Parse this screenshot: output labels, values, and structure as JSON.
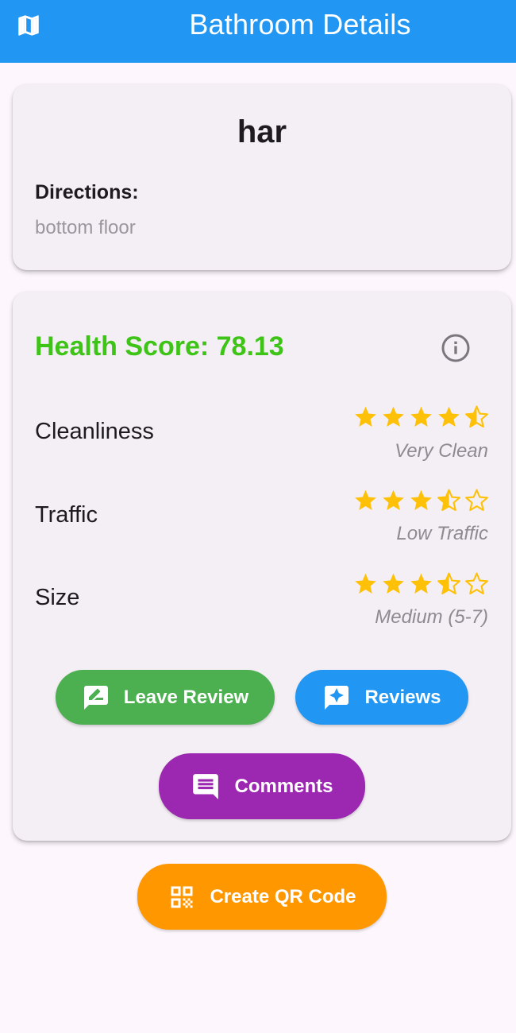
{
  "appbar": {
    "title": "Bathroom Details",
    "map_icon": "map-icon"
  },
  "bathroom": {
    "name": "har",
    "directions_label": "Directions:",
    "directions_value": "bottom floor"
  },
  "health": {
    "text": "Health Score: 78.13",
    "color": "#3dc416",
    "info_icon": "info-outline-icon"
  },
  "ratings": [
    {
      "label": "Cleanliness",
      "stars": 4.5,
      "max": 5,
      "description": "Very Clean"
    },
    {
      "label": "Traffic",
      "stars": 3.5,
      "max": 5,
      "description": "Low Traffic"
    },
    {
      "label": "Size",
      "stars": 3.5,
      "max": 5,
      "description": "Medium (5-7)"
    }
  ],
  "buttons": {
    "leave_review": {
      "label": "Leave Review",
      "icon": "rate-review-icon",
      "color": "#4caf50"
    },
    "reviews": {
      "label": "Reviews",
      "icon": "reviews-icon",
      "color": "#2196f3"
    },
    "comments": {
      "label": "Comments",
      "icon": "comment-icon",
      "color": "#9c27b0"
    },
    "qr": {
      "label": "Create QR Code",
      "icon": "qr-code-icon",
      "color": "#ff9800"
    }
  },
  "colors": {
    "app_bar": "#2196f3",
    "star": "#ffc107",
    "background": "#fdf7fd",
    "card": "#f4eff5"
  }
}
